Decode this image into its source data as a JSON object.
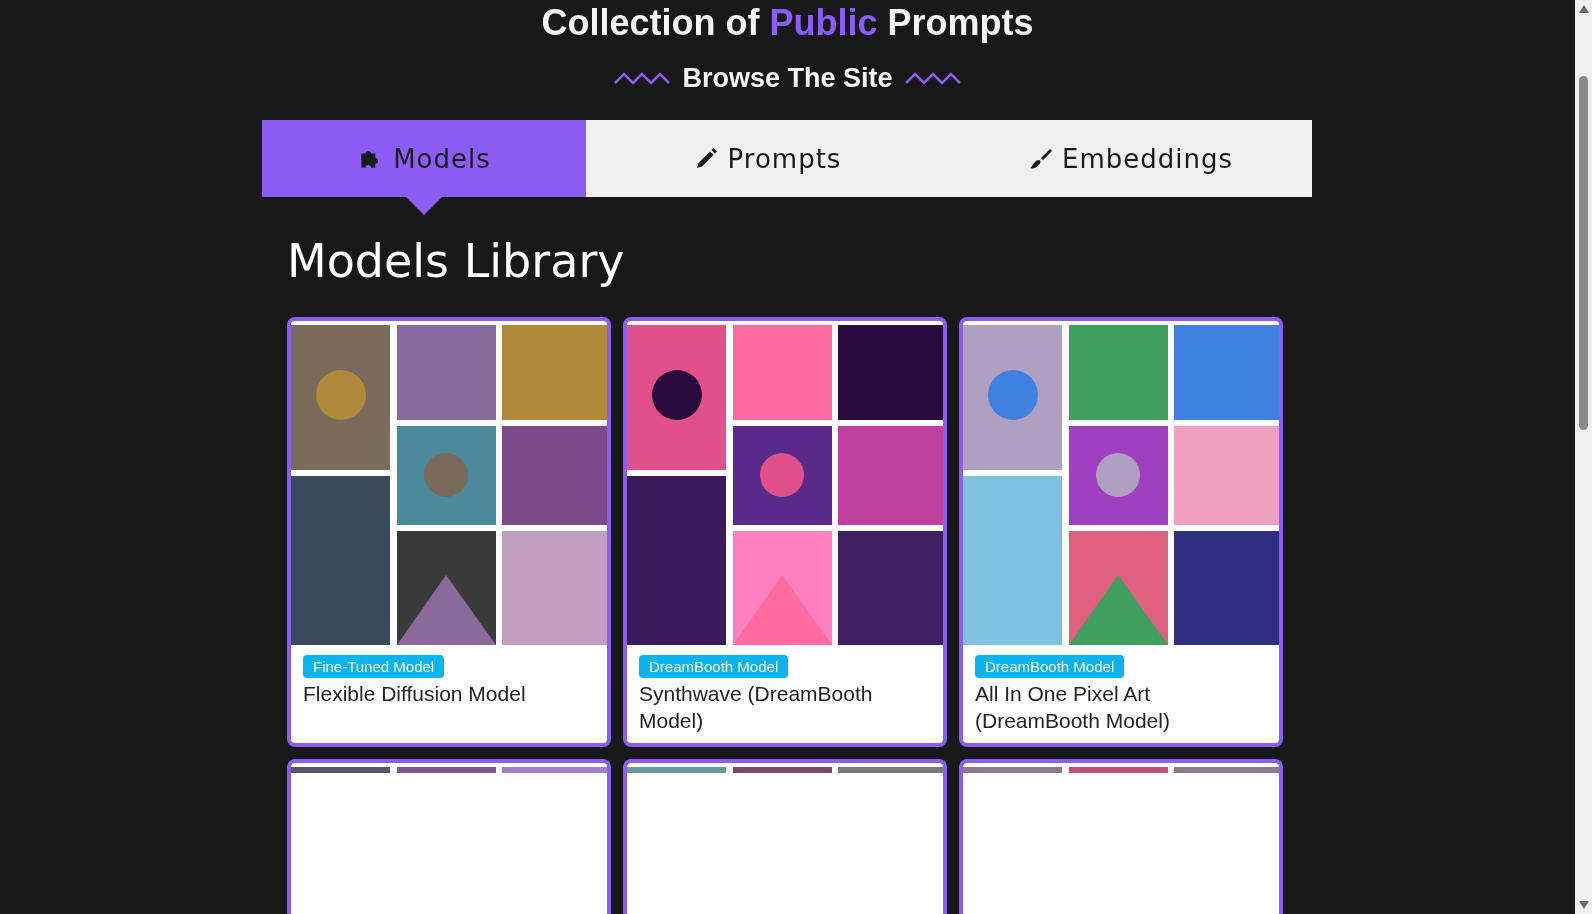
{
  "hero": {
    "before": "Collection of",
    "accent": "Public",
    "after": "Prompts"
  },
  "browse": {
    "title": "Browse The Site"
  },
  "tabs": [
    {
      "label": "Models",
      "selected": true
    },
    {
      "label": "Prompts",
      "selected": false
    },
    {
      "label": "Embeddings",
      "selected": false
    }
  ],
  "library": {
    "title": "Models Library"
  },
  "cards": [
    {
      "kind": "full",
      "badge": "Fine-Tuned Model",
      "title": "Flexible Diffusion Model"
    },
    {
      "kind": "full",
      "badge": "DreamBooth Model",
      "title": "Synthwave (DreamBooth Model)"
    },
    {
      "kind": "full",
      "badge": "DreamBooth Model",
      "title": "All In One Pixel Art (DreamBooth Model)"
    },
    {
      "kind": "cut"
    },
    {
      "kind": "cut"
    },
    {
      "kind": "cut"
    }
  ]
}
